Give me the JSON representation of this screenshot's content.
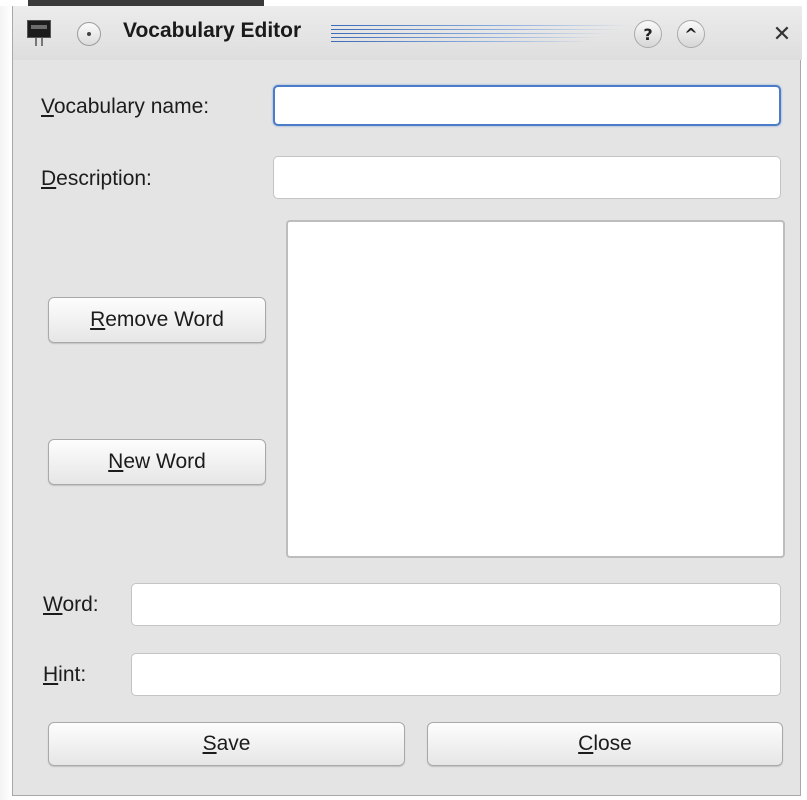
{
  "window": {
    "title": "Vocabulary Editor",
    "help_symbol": "?",
    "shade_symbol": "^",
    "close_symbol": "✕"
  },
  "form": {
    "vocabulary_name": {
      "mnemonic": "V",
      "rest": "ocabulary name:",
      "value": ""
    },
    "description": {
      "mnemonic": "D",
      "rest": "escription:",
      "value": ""
    },
    "word": {
      "mnemonic": "W",
      "rest": "ord:",
      "value": ""
    },
    "hint": {
      "mnemonic": "H",
      "rest": "int:",
      "value": ""
    }
  },
  "buttons": {
    "remove_word": {
      "mnemonic": "R",
      "rest": "emove Word"
    },
    "new_word": {
      "mnemonic": "N",
      "rest": "ew Word"
    },
    "save": {
      "mnemonic": "S",
      "rest": "ave"
    },
    "close": {
      "mnemonic": "C",
      "rest": "lose"
    }
  },
  "word_list": {
    "items": []
  },
  "colors": {
    "focus_border": "#4a7cc9",
    "window_bg": "#e4e4e4",
    "title_accent": "#3c6ab8"
  }
}
